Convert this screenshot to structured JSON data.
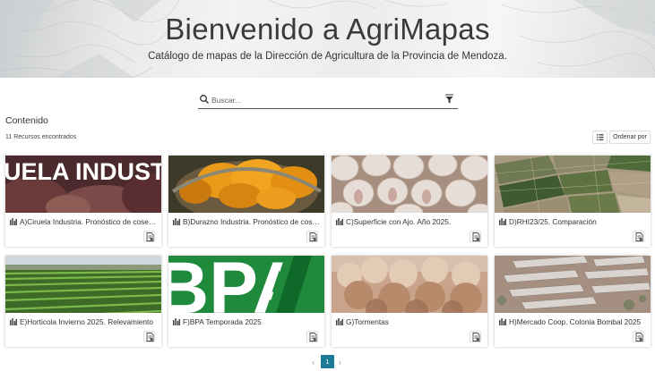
{
  "hero": {
    "title": "Bienvenido a AgriMapas",
    "subtitle": "Catálogo de mapas de la Dirección de Agricultura de la Provincia de Mendoza."
  },
  "search": {
    "placeholder": "Buscar...",
    "value": ""
  },
  "content": {
    "title": "Contenido",
    "found": "11 Recursos encontrados",
    "order_label": "Ordenar por"
  },
  "cards": [
    {
      "title": "A)Ciruela Industria. Pronóstico de cosecha",
      "thumb_text": "UELA INDUST"
    },
    {
      "title": "B)Durazno Industria. Pronóstico de cosecha"
    },
    {
      "title": "C)Superficie con Ajo. Año 2025."
    },
    {
      "title": "D)RHI23/25. Comparación"
    },
    {
      "title": "E)Horticola Invierno 2025. Relevamiento"
    },
    {
      "title": "F)BPA Temporada 2025",
      "thumb_text": "BPA"
    },
    {
      "title": "G)Tormentas"
    },
    {
      "title": "H)Mercado Coop. Colonia Bombal 2025"
    }
  ],
  "pagination": {
    "prev": "‹",
    "current": "1",
    "next": "›"
  },
  "colors": {
    "accent": "#1d7a97",
    "bpa_green": "#1f8a3c"
  },
  "icons": [
    "search-icon",
    "filter-icon",
    "list-view-icon",
    "map-icon",
    "detail-icon"
  ]
}
